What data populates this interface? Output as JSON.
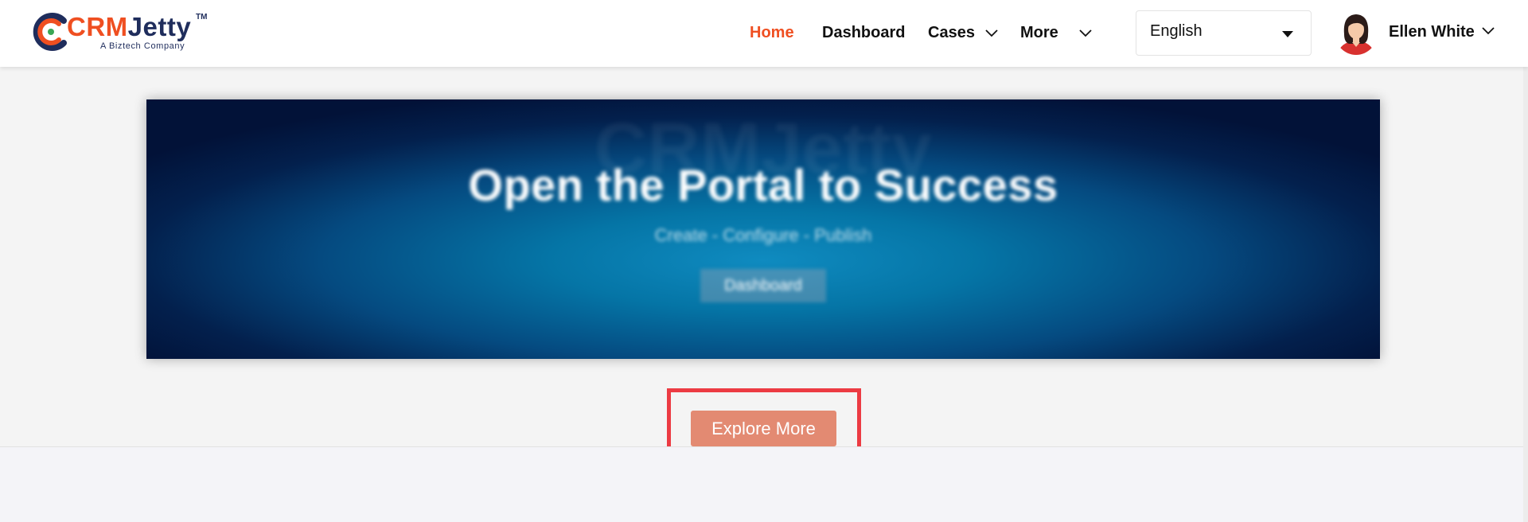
{
  "brand": {
    "logo_part1": "CRM",
    "logo_part2": "Jetty",
    "trademark": "TM",
    "tagline": "A Biztech Company",
    "colors": {
      "primary": "#ef4f21",
      "navy": "#1f2d5c"
    }
  },
  "nav": {
    "items": [
      {
        "label": "Home",
        "active": true
      },
      {
        "label": "Dashboard",
        "active": false
      },
      {
        "label": "Cases",
        "has_dropdown": true
      },
      {
        "label": "More",
        "has_dropdown": true
      }
    ]
  },
  "language_select": {
    "value": "English"
  },
  "user": {
    "name": "Ellen White"
  },
  "hero": {
    "title": "Open the Portal to Success",
    "subtitle": "Create - Configure - Publish",
    "button_label": "Dashboard",
    "background_word": "CRMJetty"
  },
  "cta": {
    "explore_label": "Explore More",
    "button_color": "#e38a72",
    "highlight_color": "#ec3b43"
  }
}
